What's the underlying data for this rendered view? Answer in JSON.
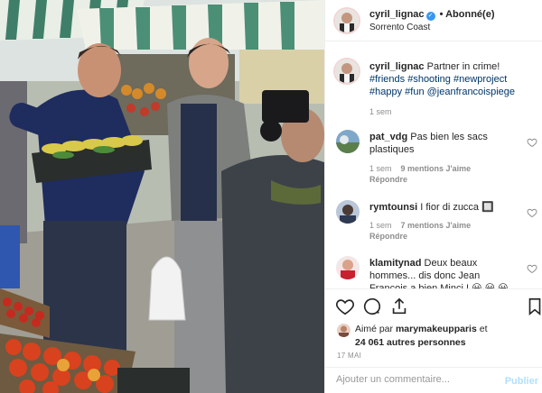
{
  "header": {
    "username": "cyril_lignac",
    "verified_icon": "verified-badge-icon",
    "follow_state": "• Abonné(e)",
    "location": "Sorrento Coast"
  },
  "caption": {
    "username": "cyril_lignac",
    "text": "Partner in crime!",
    "hashtags": [
      "#friends",
      "#shooting",
      "#newproject",
      "#happy",
      "#fun",
      "@jeanfrancoispiege"
    ],
    "time": "1 sem"
  },
  "comments": [
    {
      "username": "pat_vdg",
      "text": "Pas bien les sacs plastiques",
      "time": "1 sem",
      "likes": "9 mentions J'aime",
      "reply": "Répondre"
    },
    {
      "username": "rymtounsi",
      "text": "I fior di zucca 🔲",
      "time": "1 sem",
      "likes": "7 mentions J'aime",
      "reply": "Répondre"
    },
    {
      "username": "klamitynad",
      "text": "Deux beaux hommes... dis donc Jean Francois a bien Minci ! 😀 😀 😀"
    }
  ],
  "actions": {
    "icons": [
      "heart-icon",
      "comment-icon",
      "share-icon",
      "bookmark-icon"
    ],
    "liked_by_prefix": "Aimé par",
    "liked_by_user": "marymakeupparis",
    "liked_by_middle": "et",
    "liked_by_count": "24 061 autres personnes",
    "date": "17 MAI"
  },
  "comment_input": {
    "placeholder": "Ajouter un commentaire...",
    "post_label": "Publier"
  },
  "colors": {
    "link": "#003569",
    "verified": "#3897f0",
    "muted": "#8e8e8e",
    "post_disabled": "#b2dffc"
  }
}
